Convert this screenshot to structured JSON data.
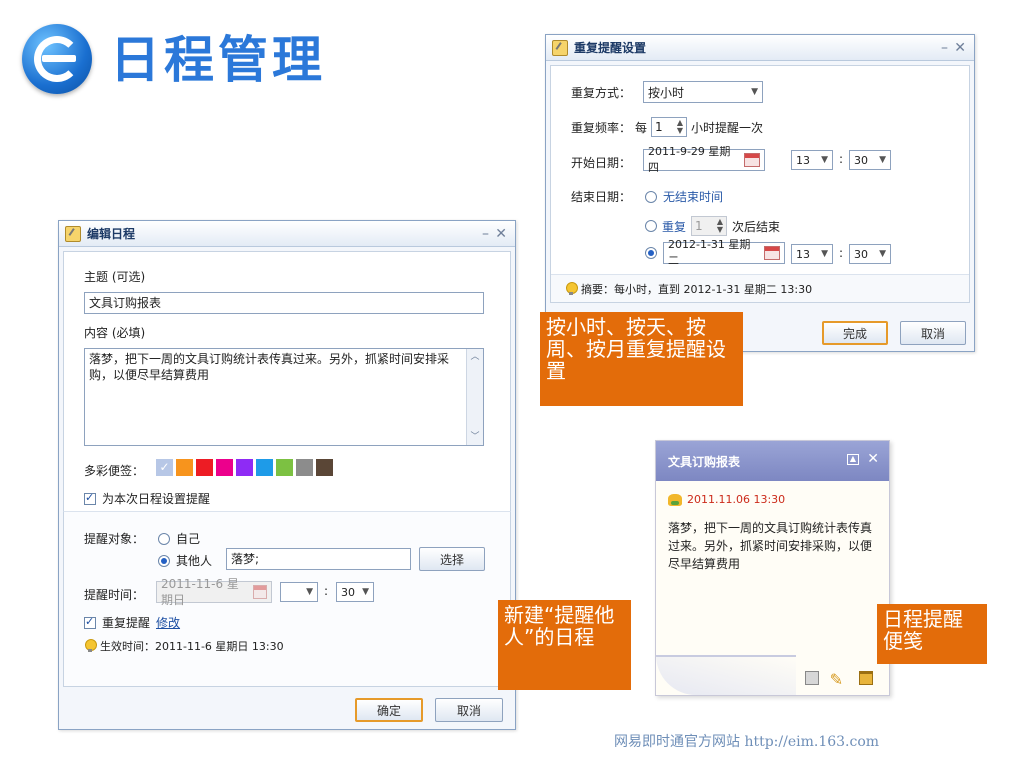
{
  "header": {
    "title": "日程管理"
  },
  "edit_dialog": {
    "title": "编辑日程",
    "subject_label": "主题 (可选)",
    "subject_value": "文具订购报表",
    "content_label": "内容 (必填)",
    "content_value": "落梦，把下一周的文具订购统计表传真过来。另外，抓紧时间安排采购，以便尽早结算费用",
    "color_label": "多彩便签：",
    "colors": [
      "#b7c7e6",
      "#f7941d",
      "#ed1c24",
      "#ec008c",
      "#8e2bf5",
      "#1e9be8",
      "#7cc142",
      "#8c8c8c",
      "#5a4636"
    ],
    "reminder_checkbox": "为本次日程设置提醒",
    "target_label": "提醒对象：",
    "target_self": "自己",
    "target_others": "其他人",
    "others_value": "落梦;",
    "choose_button": "选择",
    "time_label": "提醒时间：",
    "time_date": "2011-11-6 星期日",
    "time_hour": "",
    "time_minute": "30",
    "repeat_label": "重复提醒",
    "repeat_link": "修改",
    "effective_label": "生效时间：2011-11-6 星期日 13:30",
    "ok_button": "确定",
    "cancel_button": "取消"
  },
  "repeat_dialog": {
    "title": "重复提醒设置",
    "mode_label": "重复方式：",
    "mode_value": "按小时",
    "freq_label": "重复频率：",
    "freq_prefix": "每",
    "freq_value": "1",
    "freq_suffix": "小时提醒一次",
    "start_label": "开始日期：",
    "start_date": "2011-9-29 星期四",
    "start_hour": "13",
    "start_minute": "30",
    "end_label": "结束日期：",
    "end_none": "无结束时间",
    "end_repeat_prefix": "重复",
    "end_repeat_value": "1",
    "end_repeat_suffix": "次后结束",
    "end_date": "2012-1-31 星期二",
    "end_hour": "13",
    "end_minute": "30",
    "summary": "摘要：每小时，直到 2012-1-31 星期二 13:30",
    "done_button": "完成",
    "cancel_button": "取消"
  },
  "note": {
    "title": "文具订购报表",
    "time": "2011.11.06 13:30",
    "body": "落梦，把下一周的文具订购统计表传真过来。另外，抓紧时间安排采购，以便尽早结算费用"
  },
  "callouts": {
    "repeat": "按小时、按天、按周、按月重复提醒设置",
    "others": "新建“提醒他人”的日程",
    "note": "日程提醒便笺"
  },
  "footer": {
    "text": "网易即时通官方网站 http://eim.163.com"
  }
}
